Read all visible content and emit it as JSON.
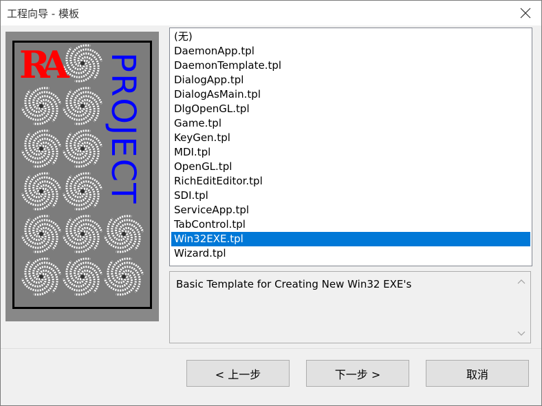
{
  "window": {
    "title": "工程向导 - 模板"
  },
  "banner": {
    "logo_text": "RA",
    "vertical_text": "PROJECT"
  },
  "template_list": {
    "items": [
      "(无)",
      "DaemonApp.tpl",
      "DaemonTemplate.tpl",
      "DialogApp.tpl",
      "DialogAsMain.tpl",
      "DlgOpenGL.tpl",
      "Game.tpl",
      "KeyGen.tpl",
      "MDI.tpl",
      "OpenGL.tpl",
      "RichEditEditor.tpl",
      "SDI.tpl",
      "ServiceApp.tpl",
      "TabControl.tpl",
      "Win32EXE.tpl",
      "Wizard.tpl"
    ],
    "selected": "Win32EXE.tpl"
  },
  "description": {
    "text": "Basic Template for Creating New Win32 EXE's"
  },
  "buttons": {
    "back": "< 上一步",
    "next": "下一步 >",
    "cancel": "取消"
  },
  "colors": {
    "selection": "#0078d7",
    "logo_red": "#ff0000",
    "project_blue": "#0000ff"
  },
  "icons": {
    "close": "close-icon",
    "scroll_up": "chevron-up-icon",
    "scroll_down": "chevron-down-icon",
    "tile": "swirl-tile-icon"
  }
}
